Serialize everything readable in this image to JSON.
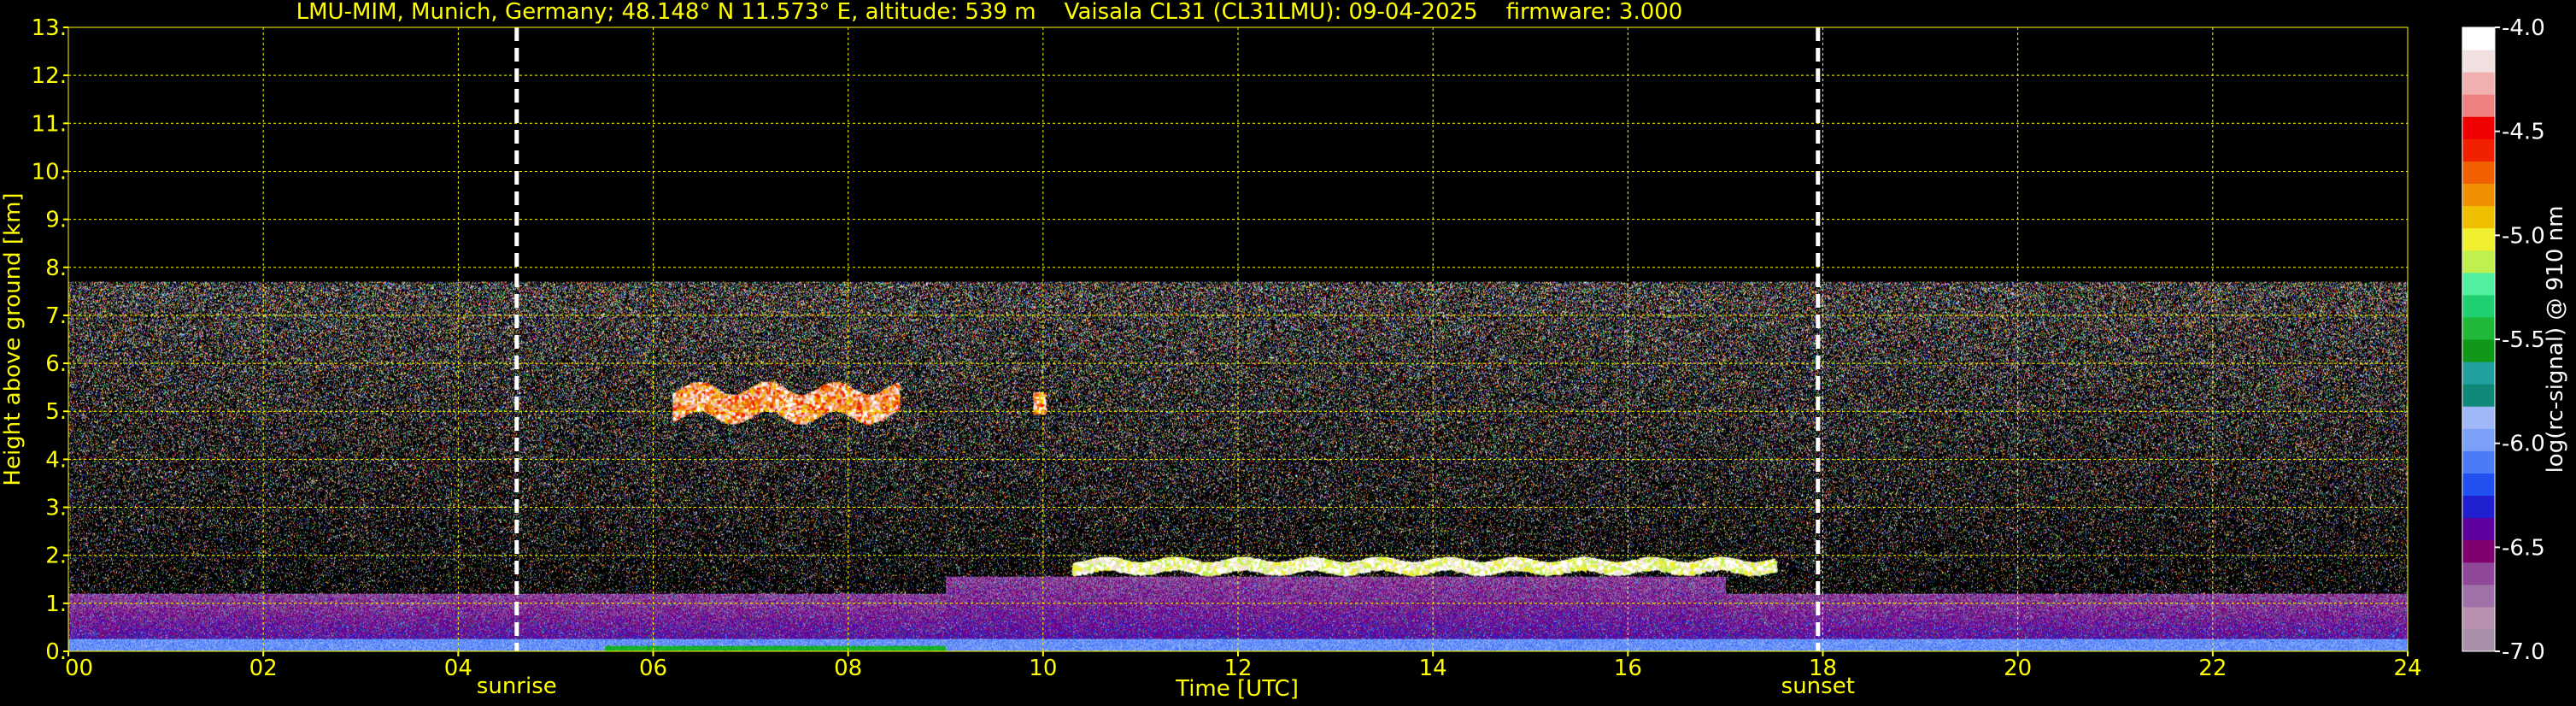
{
  "chart_data": {
    "type": "heatmap",
    "title": "LMU-MIM, Munich, Germany; 48.148° N 11.573° E, altitude: 539 m    Vaisala CL31 (CL31LMU): 09-04-2025    firmware: 3.000",
    "xlabel": "Time [UTC]",
    "ylabel": "Height above ground [km]",
    "xlim": [
      0,
      24
    ],
    "ylim": [
      0,
      13
    ],
    "x_ticks": [
      "00",
      "02",
      "04",
      "06",
      "08",
      "10",
      "12",
      "14",
      "16",
      "18",
      "20",
      "22",
      "24"
    ],
    "y_ticks": [
      "0.",
      "1.",
      "2.",
      "3.",
      "4.",
      "5.",
      "6.",
      "7.",
      "8.",
      "9.",
      "10.",
      "11.",
      "12.",
      "13."
    ],
    "grid": true,
    "data_top_km": 7.7,
    "markers": [
      {
        "label": "sunrise",
        "time": 4.6
      },
      {
        "label": "sunset",
        "time": 17.95
      }
    ],
    "colorbar": {
      "label": "log(rc-signal) @ 910 nm",
      "ticks": [
        "-4.0",
        "-4.5",
        "-5.0",
        "-5.5",
        "-6.0",
        "-6.5",
        "-7.0"
      ],
      "range": [
        -7.0,
        -4.0
      ],
      "colors": [
        "#a890a8",
        "#b890b0",
        "#a070a8",
        "#904898",
        "#800070",
        "#6000a0",
        "#2020d0",
        "#2050f0",
        "#4a7cf8",
        "#7aa0f8",
        "#a0b8f8",
        "#108878",
        "#20a0a0",
        "#109818",
        "#20b838",
        "#20d070",
        "#50f0a0",
        "#c0f050",
        "#f0f030",
        "#f0c000",
        "#f09000",
        "#f06000",
        "#f02000",
        "#f00000",
        "#f08080",
        "#f0b0b0",
        "#f0e0e0",
        "#ffffff"
      ]
    },
    "features": [
      {
        "name": "aerosol boundary layer",
        "t_start": 0,
        "t_end": 24,
        "h_top_km": 1.2
      },
      {
        "name": "mid-level cloud",
        "t_start": 6.2,
        "t_end": 8.5,
        "h_km": 5.2
      },
      {
        "name": "mid-level cloud",
        "t_start": 9.9,
        "t_end": 10.0,
        "h_km": 5.1
      },
      {
        "name": "cloud layer",
        "t_start": 10.3,
        "t_end": 17.5,
        "h_km": 1.8
      }
    ]
  }
}
